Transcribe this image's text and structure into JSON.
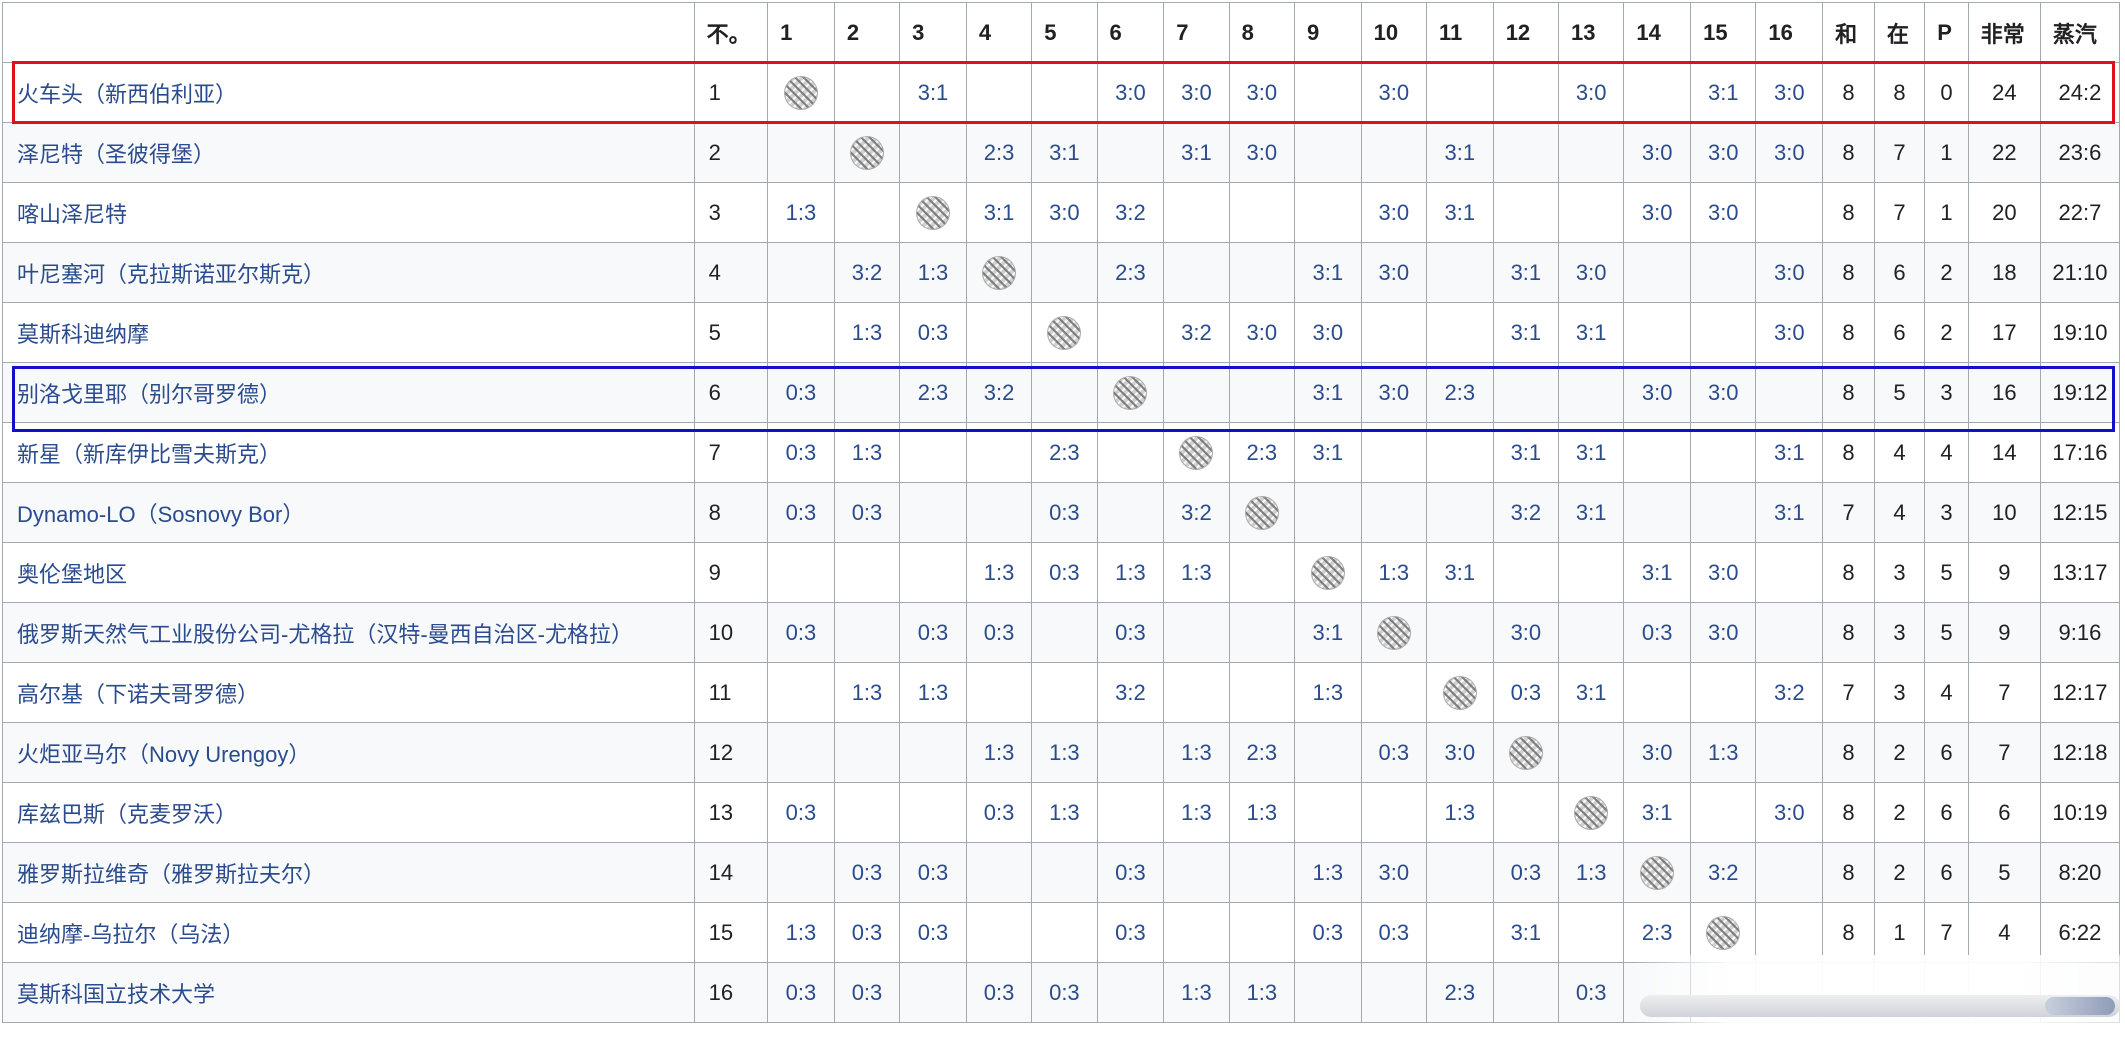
{
  "table": {
    "columns": [
      "",
      "不。",
      "1",
      "2",
      "3",
      "4",
      "5",
      "6",
      "7",
      "8",
      "9",
      "10",
      "11",
      "12",
      "13",
      "14",
      "15",
      "16",
      "和",
      "在",
      "P",
      "非常",
      "蒸汽"
    ],
    "rows": [
      {
        "team": "火车头（新西伯利亚）",
        "pos": "1",
        "results": [
          "self",
          "",
          "3:1",
          "",
          "",
          "3:0",
          "3:0",
          "3:0",
          "",
          "3:0",
          "",
          "",
          "3:0",
          "",
          "3:1",
          "3:0"
        ],
        "played": "8",
        "won": "8",
        "lost": "0",
        "points": "24",
        "sets": "24:2"
      },
      {
        "team": "泽尼特（圣彼得堡）",
        "pos": "2",
        "results": [
          "",
          "self",
          "",
          "2:3",
          "3:1",
          "",
          "3:1",
          "3:0",
          "",
          "",
          "3:1",
          "",
          "",
          "3:0",
          "3:0",
          "3:0"
        ],
        "played": "8",
        "won": "7",
        "lost": "1",
        "points": "22",
        "sets": "23:6"
      },
      {
        "team": "喀山泽尼特",
        "pos": "3",
        "results": [
          "1:3",
          "",
          "self",
          "3:1",
          "3:0",
          "3:2",
          "",
          "",
          "",
          "3:0",
          "3:1",
          "",
          "",
          "3:0",
          "3:0",
          ""
        ],
        "played": "8",
        "won": "7",
        "lost": "1",
        "points": "20",
        "sets": "22:7"
      },
      {
        "team": "叶尼塞河（克拉斯诺亚尔斯克）",
        "pos": "4",
        "results": [
          "",
          "3:2",
          "1:3",
          "self",
          "",
          "2:3",
          "",
          "",
          "3:1",
          "3:0",
          "",
          "3:1",
          "3:0",
          "",
          "",
          "3:0"
        ],
        "played": "8",
        "won": "6",
        "lost": "2",
        "points": "18",
        "sets": "21:10"
      },
      {
        "team": "莫斯科迪纳摩",
        "pos": "5",
        "results": [
          "",
          "1:3",
          "0:3",
          "",
          "self",
          "",
          "3:2",
          "3:0",
          "3:0",
          "",
          "",
          "3:1",
          "3:1",
          "",
          "",
          "3:0"
        ],
        "played": "8",
        "won": "6",
        "lost": "2",
        "points": "17",
        "sets": "19:10"
      },
      {
        "team": "别洛戈里耶（别尔哥罗德）",
        "pos": "6",
        "results": [
          "0:3",
          "",
          "2:3",
          "3:2",
          "",
          "self",
          "",
          "",
          "3:1",
          "3:0",
          "2:3",
          "",
          "",
          "3:0",
          "3:0",
          ""
        ],
        "played": "8",
        "won": "5",
        "lost": "3",
        "points": "16",
        "sets": "19:12"
      },
      {
        "team": "新星（新库伊比雪夫斯克）",
        "pos": "7",
        "results": [
          "0:3",
          "1:3",
          "",
          "",
          "2:3",
          "",
          "self",
          "2:3",
          "3:1",
          "",
          "",
          "3:1",
          "3:1",
          "",
          "",
          "3:1"
        ],
        "played": "8",
        "won": "4",
        "lost": "4",
        "points": "14",
        "sets": "17:16"
      },
      {
        "team": "Dynamo-LO（Sosnovy Bor）",
        "pos": "8",
        "results": [
          "0:3",
          "0:3",
          "",
          "",
          "0:3",
          "",
          "3:2",
          "self",
          "",
          "",
          "",
          "3:2",
          "3:1",
          "",
          "",
          "3:1"
        ],
        "played": "7",
        "won": "4",
        "lost": "3",
        "points": "10",
        "sets": "12:15"
      },
      {
        "team": "奥伦堡地区",
        "pos": "9",
        "results": [
          "",
          "",
          "",
          "1:3",
          "0:3",
          "1:3",
          "1:3",
          "",
          "self",
          "1:3",
          "3:1",
          "",
          "",
          "3:1",
          "3:0",
          ""
        ],
        "played": "8",
        "won": "3",
        "lost": "5",
        "points": "9",
        "sets": "13:17"
      },
      {
        "team": "俄罗斯天然气工业股份公司-尤格拉（汉特-曼西自治区-尤格拉）",
        "pos": "10",
        "results": [
          "0:3",
          "",
          "0:3",
          "0:3",
          "",
          "0:3",
          "",
          "",
          "3:1",
          "self",
          "",
          "3:0",
          "",
          "0:3",
          "3:0",
          ""
        ],
        "played": "8",
        "won": "3",
        "lost": "5",
        "points": "9",
        "sets": "9:16"
      },
      {
        "team": "高尔基（下诺夫哥罗德）",
        "pos": "11",
        "results": [
          "",
          "1:3",
          "1:3",
          "",
          "",
          "3:2",
          "",
          "",
          "1:3",
          "",
          "self",
          "0:3",
          "3:1",
          "",
          "",
          "3:2"
        ],
        "played": "7",
        "won": "3",
        "lost": "4",
        "points": "7",
        "sets": "12:17"
      },
      {
        "team": "火炬亚马尔（Novy Urengoy）",
        "pos": "12",
        "results": [
          "",
          "",
          "",
          "1:3",
          "1:3",
          "",
          "1:3",
          "2:3",
          "",
          "0:3",
          "3:0",
          "self",
          "",
          "3:0",
          "1:3",
          ""
        ],
        "played": "8",
        "won": "2",
        "lost": "6",
        "points": "7",
        "sets": "12:18"
      },
      {
        "team": "库兹巴斯（克麦罗沃）",
        "pos": "13",
        "results": [
          "0:3",
          "",
          "",
          "0:3",
          "1:3",
          "",
          "1:3",
          "1:3",
          "",
          "",
          "1:3",
          "",
          "self",
          "3:1",
          "",
          "3:0"
        ],
        "played": "8",
        "won": "2",
        "lost": "6",
        "points": "6",
        "sets": "10:19"
      },
      {
        "team": "雅罗斯拉维奇（雅罗斯拉夫尔）",
        "pos": "14",
        "results": [
          "",
          "0:3",
          "0:3",
          "",
          "",
          "0:3",
          "",
          "",
          "1:3",
          "3:0",
          "",
          "0:3",
          "1:3",
          "self",
          "3:2",
          ""
        ],
        "played": "8",
        "won": "2",
        "lost": "6",
        "points": "5",
        "sets": "8:20"
      },
      {
        "team": "迪纳摩-乌拉尔（乌法）",
        "pos": "15",
        "results": [
          "1:3",
          "0:3",
          "0:3",
          "",
          "",
          "0:3",
          "",
          "",
          "0:3",
          "0:3",
          "",
          "3:1",
          "",
          "2:3",
          "self",
          ""
        ],
        "played": "8",
        "won": "1",
        "lost": "7",
        "points": "4",
        "sets": "6:22"
      },
      {
        "team": "莫斯科国立技术大学",
        "pos": "16",
        "results": [
          "0:3",
          "0:3",
          "",
          "0:3",
          "0:3",
          "",
          "1:3",
          "1:3",
          "",
          "",
          "2:3",
          "",
          "0:3",
          "",
          "",
          ""
        ],
        "played": "",
        "won": "",
        "lost": "",
        "points": "",
        "sets": ""
      }
    ]
  },
  "highlights": {
    "red_row": "1",
    "blue_row": "6",
    "red_color": "#e0101a",
    "blue_color": "#1010c8"
  },
  "colors": {
    "link": "#2a4b8d",
    "border": "#a2a9b1",
    "stripe": "#f8f9fa"
  },
  "icons": {
    "self_match": "crosshatch-ball-icon"
  }
}
